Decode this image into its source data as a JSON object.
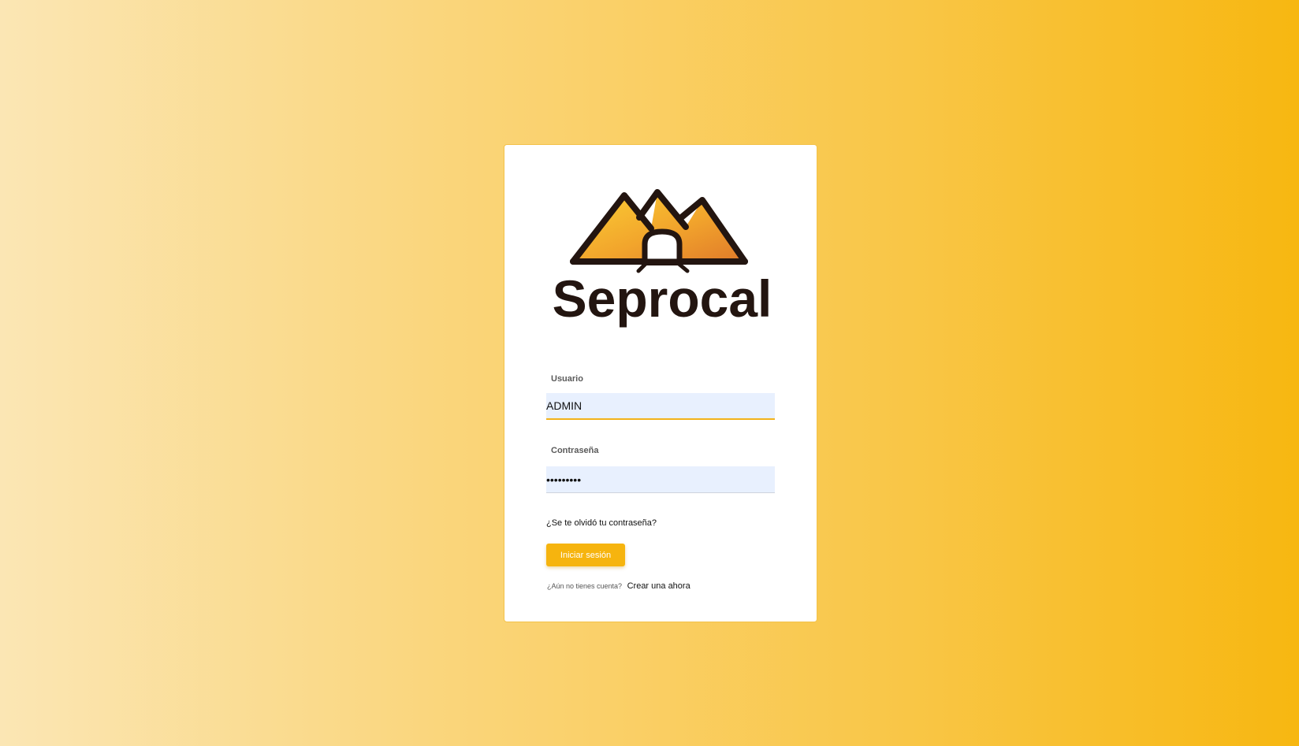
{
  "brand": {
    "name": "Seprocal"
  },
  "form": {
    "username_label": "Usuario",
    "username_value": "ADMIN",
    "password_label": "Contraseña",
    "password_value": "•••••••••",
    "forgot_link": "¿Se te olvidó tu contraseña?",
    "login_button": "Iniciar sesión",
    "no_account_text": "¿Aún no tienes cuenta?",
    "signup_link": "Crear una ahora"
  },
  "colors": {
    "accent": "#f6b40e",
    "logo_dark": "#231510"
  }
}
